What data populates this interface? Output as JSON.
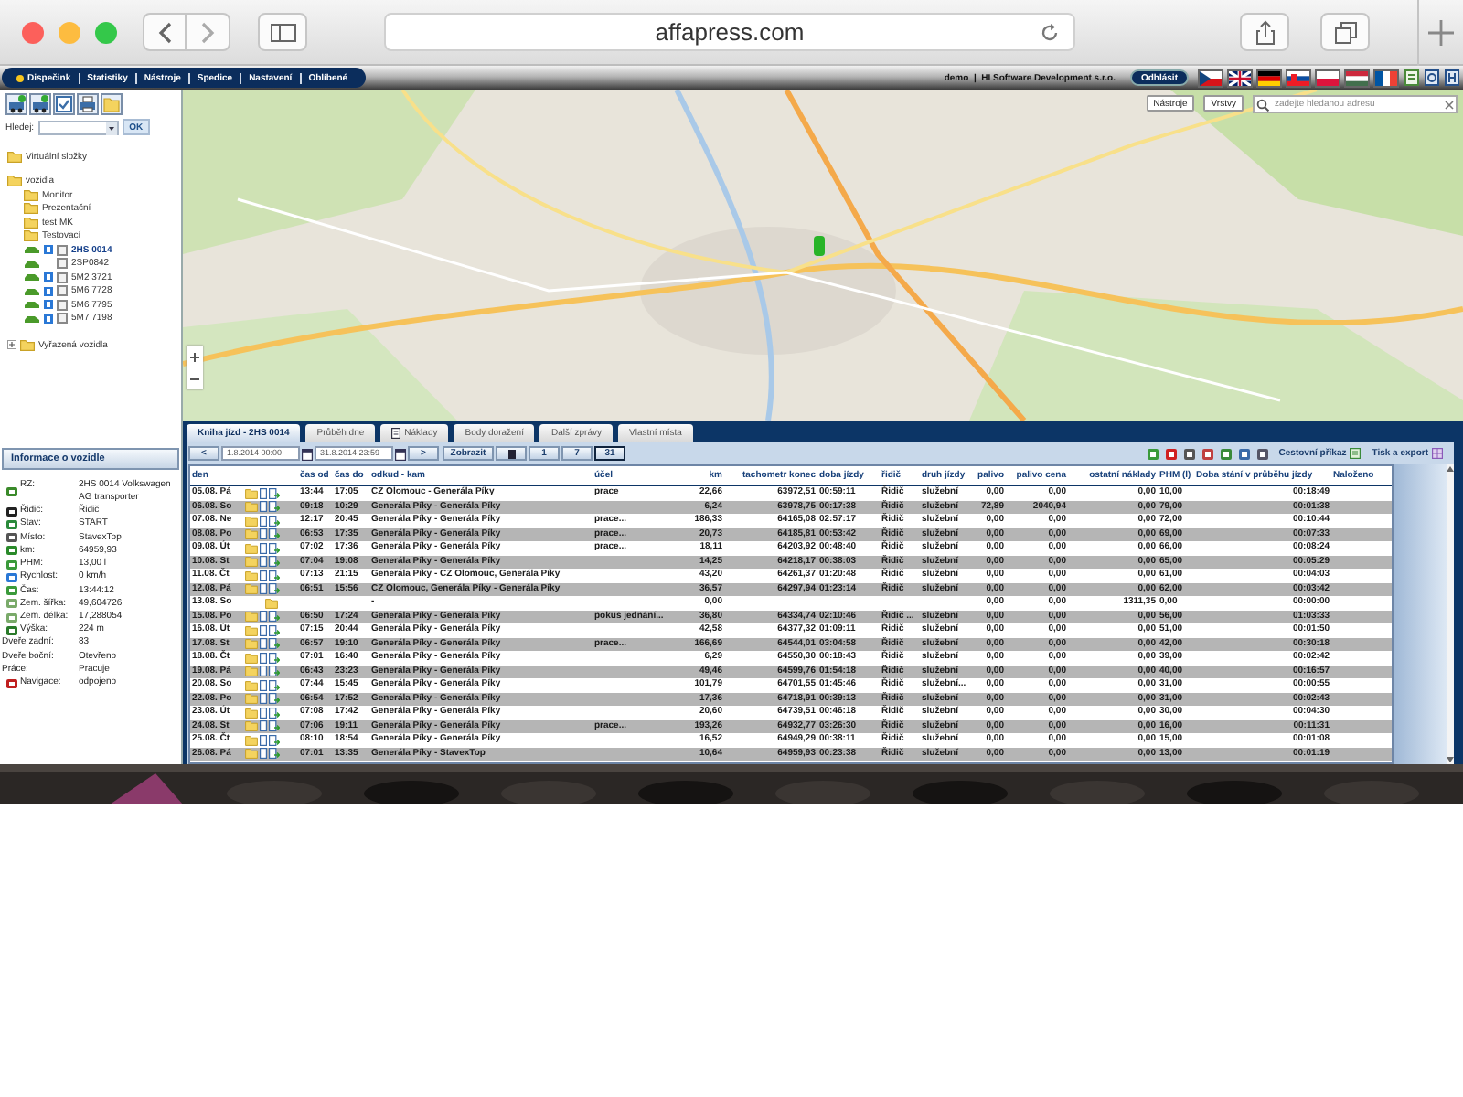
{
  "browser": {
    "address": "affapress.com"
  },
  "menu": [
    {
      "label": "Dispečink",
      "selected": true
    },
    {
      "label": "Statistiky",
      "selected": false
    },
    {
      "label": "Nástroje",
      "selected": false
    },
    {
      "label": "Spedice",
      "selected": false
    },
    {
      "label": "Nastavení",
      "selected": false
    },
    {
      "label": "Oblíbené",
      "selected": false
    }
  ],
  "user": {
    "text": "demo  |  HI Software Development s.r.o.",
    "logout": "Odhlásit"
  },
  "sidebar": {
    "search": {
      "label": "Hledej:",
      "button": "OK"
    },
    "tree": [
      {
        "label": "Virtuální složky",
        "kind": "folder"
      },
      {
        "label": "vozidla",
        "kind": "folder",
        "expanded": true,
        "children": [
          {
            "label": "Monitor",
            "kind": "folder"
          },
          {
            "label": "Prezentační",
            "kind": "folder"
          },
          {
            "label": "test MK",
            "kind": "folder"
          },
          {
            "label": "Testovací",
            "kind": "folder"
          },
          {
            "label": "2HS 0014",
            "kind": "vehicle",
            "online": true,
            "checked": false,
            "selected": true
          },
          {
            "label": "2SP0842",
            "kind": "vehicle",
            "online": false,
            "checked": false,
            "selected": false
          },
          {
            "label": "5M2 3721",
            "kind": "vehicle",
            "online": true,
            "checked": false,
            "selected": false
          },
          {
            "label": "5M6 7728",
            "kind": "vehicle",
            "online": true,
            "checked": false,
            "selected": false
          },
          {
            "label": "5M6 7795",
            "kind": "vehicle",
            "online": true,
            "checked": false,
            "selected": false
          },
          {
            "label": "5M7 7198",
            "kind": "vehicle",
            "online": true,
            "checked": false,
            "selected": false
          }
        ]
      },
      {
        "label": "Vyřazená vozidla",
        "kind": "folder",
        "expanded": false
      }
    ],
    "info": {
      "title": "Informace o vozidle",
      "rows": [
        {
          "label": "RZ:",
          "value": "2HS 0014 Volkswagen AG transporter",
          "kind": "icon"
        },
        {
          "label": "Řidič:",
          "value": "Řidič",
          "kind": "icon"
        },
        {
          "label": "Stav:",
          "value": "START",
          "kind": "icon"
        },
        {
          "label": "Místo:",
          "value": "StavexTop",
          "kind": "icon"
        },
        {
          "label": "km:",
          "value": "64959,93",
          "kind": "icon"
        },
        {
          "label": "PHM:",
          "value": "13,00 l",
          "kind": "icon"
        },
        {
          "label": "Rychlost:",
          "value": "0 km/h",
          "kind": "icon"
        },
        {
          "label": "Čas:",
          "value": "13:44:12",
          "kind": "icon"
        },
        {
          "label": "Zem. šířka:",
          "value": "49,604726",
          "kind": "icon"
        },
        {
          "label": "Zem. délka:",
          "value": "17,288054",
          "kind": "icon"
        },
        {
          "label": "Výška:",
          "value": "224 m",
          "kind": "icon"
        },
        {
          "label": "Dveře zadní:",
          "value": "83",
          "kind": "plain"
        },
        {
          "label": "Dveře boční:",
          "value": "Otevřeno",
          "kind": "plain"
        },
        {
          "label": "Práce:",
          "value": "Pracuje",
          "kind": "plain"
        },
        {
          "label": "Navigace:",
          "value": "odpojeno",
          "kind": "icon"
        }
      ]
    }
  },
  "map": {
    "kind": "picture",
    "buttons": [
      "Nástroje",
      "Vrstvy"
    ],
    "search": {
      "placeholder": "zadejte hledanou adresu"
    }
  },
  "tabs": [
    {
      "label": "Kniha jízd - 2HS 0014",
      "selected": true
    },
    {
      "label": "Průběh dne",
      "selected": false
    },
    {
      "label": "Náklady",
      "selected": false,
      "icon": true
    },
    {
      "label": "Body doražení",
      "selected": false
    },
    {
      "label": "Další zprávy",
      "selected": false
    },
    {
      "label": "Vlastní místa",
      "selected": false
    }
  ],
  "toolbar": {
    "prev": "<",
    "from": "1.8.2014 00:00",
    "to": "31.8.2014 23:59",
    "next": ">",
    "show": "Zobrazit",
    "periods": [
      {
        "label": "1",
        "selected": false
      },
      {
        "label": "7",
        "selected": false
      },
      {
        "label": "31",
        "selected": true
      }
    ],
    "links": [
      "Cestovní příkaz",
      "Tisk a export"
    ]
  },
  "table": {
    "columns": [
      "den",
      "čas od",
      "čas do",
      "odkud - kam",
      "účel",
      "km",
      "tachometr konec",
      "doba jízdy",
      "řidič",
      "druh jízdy",
      "palivo",
      "palivo cena",
      "ostatní náklady",
      "PHM (l)",
      "Doba stání v průběhu jízdy",
      "Naloženo"
    ],
    "rows": [
      {
        "kind": "trip",
        "cells": [
          "05.08. Pá",
          "13:44",
          "17:05",
          "CZ Olomouc - Generála Píky",
          "prace",
          "22,66",
          "63972,51",
          "00:59:11",
          "Řidič",
          "služební",
          "0,00",
          "0,00",
          "0,00",
          "10,00",
          "00:18:49"
        ]
      },
      {
        "kind": "trip",
        "cells": [
          "06.08. So",
          "09:18",
          "10:29",
          "Generála Píky - Generála Píky",
          null,
          "6,24",
          "63978,75",
          "00:17:38",
          "Řidič",
          "služební",
          "72,89",
          "2040,94",
          "0,00",
          "79,00",
          "00:01:38"
        ]
      },
      {
        "kind": "trip",
        "cells": [
          "07.08. Ne",
          "12:17",
          "20:45",
          "Generála Píky - Generála Píky",
          "prace...",
          "186,33",
          "64165,08",
          "02:57:17",
          "Řidič",
          "služební",
          "0,00",
          "0,00",
          "0,00",
          "72,00",
          "00:10:44"
        ]
      },
      {
        "kind": "trip",
        "cells": [
          "08.08. Po",
          "06:53",
          "17:35",
          "Generála Píky - Generála Píky",
          "prace...",
          "20,73",
          "64185,81",
          "00:53:42",
          "Řidič",
          "služební",
          "0,00",
          "0,00",
          "0,00",
          "69,00",
          "00:07:33"
        ]
      },
      {
        "kind": "trip",
        "cells": [
          "09.08. Út",
          "07:02",
          "17:36",
          "Generála Píky - Generála Píky",
          "prace...",
          "18,11",
          "64203,92",
          "00:48:40",
          "Řidič",
          "služební",
          "0,00",
          "0,00",
          "0,00",
          "66,00",
          "00:08:24"
        ]
      },
      {
        "kind": "trip",
        "cells": [
          "10.08. St",
          "07:04",
          "19:08",
          "Generála Píky - Generála Píky",
          null,
          "14,25",
          "64218,17",
          "00:38:03",
          "Řidič",
          "služební",
          "0,00",
          "0,00",
          "0,00",
          "65,00",
          "00:05:29"
        ]
      },
      {
        "kind": "trip",
        "cells": [
          "11.08. Čt",
          "07:13",
          "21:15",
          "Generála Píky - CZ Olomouc, Generála Píky",
          null,
          "43,20",
          "64261,37",
          "01:20:48",
          "Řidič",
          "služební",
          "0,00",
          "0,00",
          "0,00",
          "61,00",
          "00:04:03"
        ]
      },
      {
        "kind": "trip",
        "cells": [
          "12.08. Pá",
          "06:51",
          "15:56",
          "CZ Olomouc, Generála Píky - Generála Píky",
          null,
          "36,57",
          "64297,94",
          "01:23:14",
          "Řidič",
          "služební",
          "0,00",
          "0,00",
          "0,00",
          "62,00",
          "00:03:42"
        ]
      },
      {
        "kind": "empty",
        "cells": [
          "13.08. So",
          null,
          null,
          "-",
          null,
          "0,00",
          null,
          null,
          null,
          null,
          "0,00",
          "0,00",
          "1311,35",
          "0,00",
          "00:00:00"
        ]
      },
      {
        "kind": "trip",
        "cells": [
          "15.08. Po",
          "06:50",
          "17:24",
          "Generála Píky - Generála Píky",
          "pokus jednání...",
          "36,80",
          "64334,74",
          "02:10:46",
          "Řidič ...",
          "služební",
          "0,00",
          "0,00",
          "0,00",
          "56,00",
          "01:03:33"
        ]
      },
      {
        "kind": "trip",
        "cells": [
          "16.08. Út",
          "07:15",
          "20:44",
          "Generála Píky - Generála Píky",
          null,
          "42,58",
          "64377,32",
          "01:09:11",
          "Řidič",
          "služební",
          "0,00",
          "0,00",
          "0,00",
          "51,00",
          "00:01:50"
        ]
      },
      {
        "kind": "trip",
        "cells": [
          "17.08. St",
          "06:57",
          "19:10",
          "Generála Píky - Generála Píky",
          "prace...",
          "166,69",
          "64544,01",
          "03:04:58",
          "Řidič",
          "služební",
          "0,00",
          "0,00",
          "0,00",
          "42,00",
          "00:30:18"
        ]
      },
      {
        "kind": "trip",
        "cells": [
          "18.08. Čt",
          "07:01",
          "16:40",
          "Generála Píky - Generála Píky",
          null,
          "6,29",
          "64550,30",
          "00:18:43",
          "Řidič",
          "služební",
          "0,00",
          "0,00",
          "0,00",
          "39,00",
          "00:02:42"
        ]
      },
      {
        "kind": "trip",
        "cells": [
          "19.08. Pá",
          "06:43",
          "23:23",
          "Generála Píky - Generála Píky",
          null,
          "49,46",
          "64599,76",
          "01:54:18",
          "Řidič",
          "služební",
          "0,00",
          "0,00",
          "0,00",
          "40,00",
          "00:16:57"
        ]
      },
      {
        "kind": "trip",
        "cells": [
          "20.08. So",
          "07:44",
          "15:45",
          "Generála Píky - Generála Píky",
          null,
          "101,79",
          "64701,55",
          "01:45:46",
          "Řidič",
          "služební...",
          "0,00",
          "0,00",
          "0,00",
          "31,00",
          "00:00:55"
        ]
      },
      {
        "kind": "trip",
        "cells": [
          "22.08. Po",
          "06:54",
          "17:52",
          "Generála Píky - Generála Píky",
          null,
          "17,36",
          "64718,91",
          "00:39:13",
          "Řidič",
          "služební",
          "0,00",
          "0,00",
          "0,00",
          "31,00",
          "00:02:43"
        ]
      },
      {
        "kind": "trip",
        "cells": [
          "23.08. Út",
          "07:08",
          "17:42",
          "Generála Píky - Generála Píky",
          null,
          "20,60",
          "64739,51",
          "00:46:18",
          "Řidič",
          "služební",
          "0,00",
          "0,00",
          "0,00",
          "30,00",
          "00:04:30"
        ]
      },
      {
        "kind": "trip",
        "cells": [
          "24.08. St",
          "07:06",
          "19:11",
          "Generála Píky - Generála Píky",
          "prace...",
          "193,26",
          "64932,77",
          "03:26:30",
          "Řidič",
          "služební",
          "0,00",
          "0,00",
          "0,00",
          "16,00",
          "00:11:31"
        ]
      },
      {
        "kind": "trip",
        "cells": [
          "25.08. Čt",
          "08:10",
          "18:54",
          "Generála Píky - Generála Píky",
          null,
          "16,52",
          "64949,29",
          "00:38:11",
          "Řidič",
          "služební",
          "0,00",
          "0,00",
          "0,00",
          "15,00",
          "00:01:08"
        ]
      },
      {
        "kind": "trip",
        "cells": [
          "26.08. Pá",
          "07:01",
          "13:35",
          "Generála Píky - StavexTop",
          null,
          "10,64",
          "64959,93",
          "00:23:38",
          "Řidič",
          "služební",
          "0,00",
          "0,00",
          "0,00",
          "13,00",
          "00:01:19"
        ]
      }
    ]
  }
}
